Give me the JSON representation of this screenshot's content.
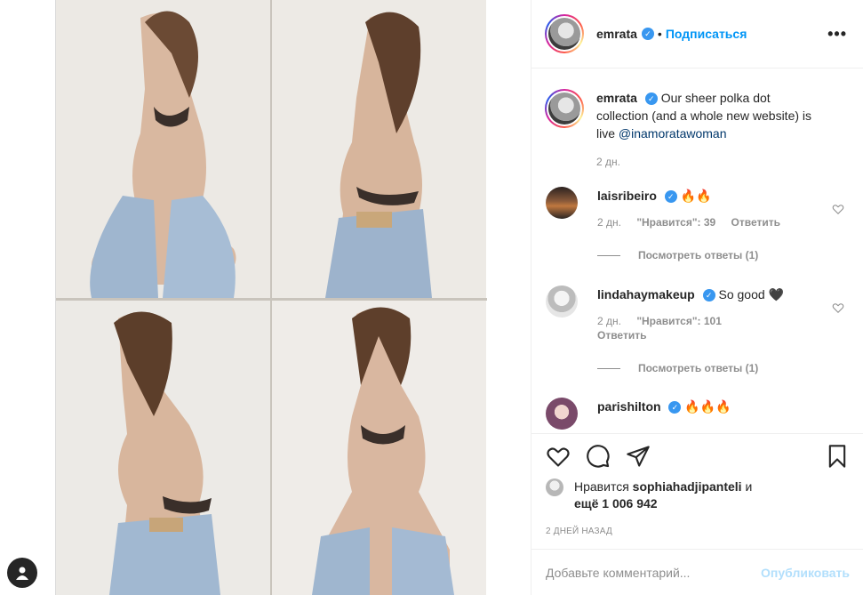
{
  "post": {
    "photo_description_icon": "photo-collage",
    "author": {
      "username": "emrata",
      "verified_icon": "verified-badge-icon"
    },
    "follow_label": "Подписаться",
    "more_icon": "more-options-icon",
    "caption": {
      "username": "emrata",
      "text": "Our sheer polka dot collection (and a whole new website) is live ",
      "mention": "@inamoratawoman",
      "time": "2 дн."
    }
  },
  "comments": [
    {
      "username": "laisribeiro",
      "text": "🔥🔥",
      "time": "2 дн.",
      "likes": "\"Нравится\": 39",
      "reply": "Ответить",
      "view_replies": "Посмотреть ответы (1)"
    },
    {
      "username": "lindahaymakeup",
      "text": "So good 🖤",
      "time": "2 дн.",
      "likes": "\"Нравится\": 101",
      "reply": "Ответить",
      "view_replies": "Посмотреть ответы (1)"
    },
    {
      "username": "parishilton",
      "text": "🔥🔥🔥"
    }
  ],
  "likes_summary": {
    "prefix": "Нравится ",
    "user": "sophiahadjipanteli",
    "suffix": " и",
    "count_line": "ещё 1 006 942"
  },
  "timestamp": "2 ДНЕЙ НАЗАД",
  "add_comment": {
    "placeholder": "Добавьте комментарий...",
    "publish_label": "Опубликовать"
  },
  "colors": {
    "accent": "#0095f6",
    "verified": "#3897f0",
    "publish_disabled": "#b2dffc"
  }
}
